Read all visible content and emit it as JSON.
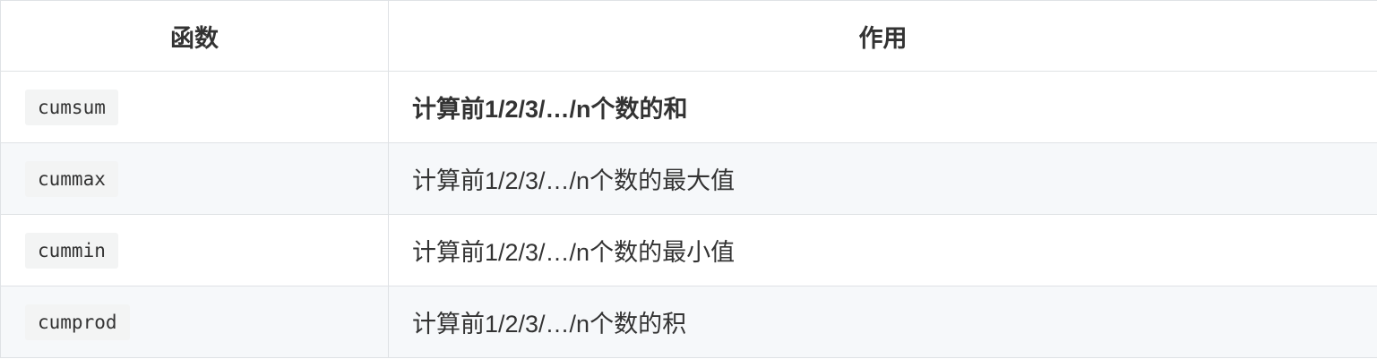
{
  "table": {
    "headers": [
      "函数",
      "作用"
    ],
    "rows": [
      {
        "function": "cumsum",
        "description": "计算前1/2/3/…/n个数的和",
        "bold": true
      },
      {
        "function": "cummax",
        "description": "计算前1/2/3/…/n个数的最大值",
        "bold": false
      },
      {
        "function": "cummin",
        "description": "计算前1/2/3/…/n个数的最小值",
        "bold": false
      },
      {
        "function": "cumprod",
        "description": "计算前1/2/3/…/n个数的积",
        "bold": false
      }
    ]
  },
  "colors": {
    "border": "#dfe2e5",
    "stripe": "#f6f8fa",
    "code_bg": "#f3f4f4",
    "text": "#333333"
  }
}
